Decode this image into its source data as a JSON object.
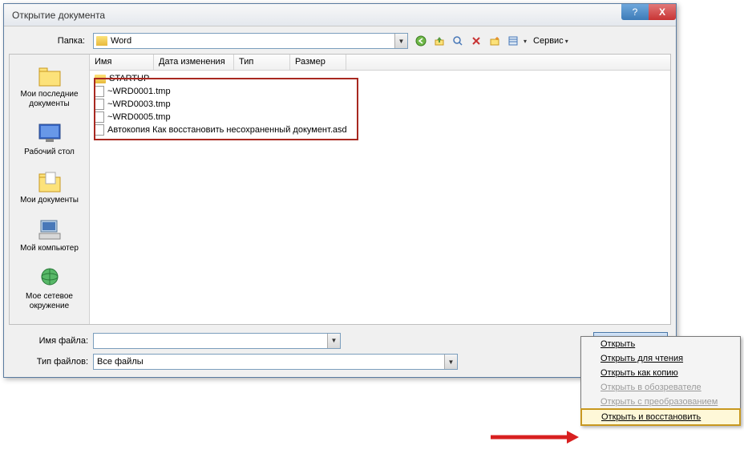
{
  "titlebar": {
    "text": "Открытие документа"
  },
  "toprow": {
    "label": "Папка:",
    "folder": "Word",
    "service_label": "Сервис"
  },
  "sidebar": {
    "items": [
      {
        "label": "Мои последние документы"
      },
      {
        "label": "Рабочий стол"
      },
      {
        "label": "Мои документы"
      },
      {
        "label": "Мой компьютер"
      },
      {
        "label": "Мое сетевое окружение"
      }
    ]
  },
  "list": {
    "cols": [
      "Имя",
      "Дата изменения",
      "Тип",
      "Размер"
    ],
    "rows": [
      {
        "type": "folder",
        "name": "STARTUP"
      },
      {
        "type": "file",
        "name": "~WRD0001.tmp"
      },
      {
        "type": "file",
        "name": "~WRD0003.tmp"
      },
      {
        "type": "file",
        "name": "~WRD0005.tmp"
      },
      {
        "type": "file",
        "name": "Автокопия Как восстановить несохраненный документ.asd"
      }
    ]
  },
  "bottom": {
    "filename_label": "Имя файла:",
    "filename_value": "",
    "filetype_label": "Тип файлов:",
    "filetype_value": "Все файлы",
    "open_label": "Открыть"
  },
  "menu": {
    "items": [
      {
        "label": "Открыть",
        "disabled": false
      },
      {
        "label": "Открыть для чтения",
        "disabled": false
      },
      {
        "label": "Открыть как копию",
        "disabled": false
      },
      {
        "label": "Открыть в обозревателе",
        "disabled": true
      },
      {
        "label": "Открыть с преобразованием",
        "disabled": true
      },
      {
        "label": "Открыть и восстановить",
        "disabled": false
      }
    ]
  }
}
